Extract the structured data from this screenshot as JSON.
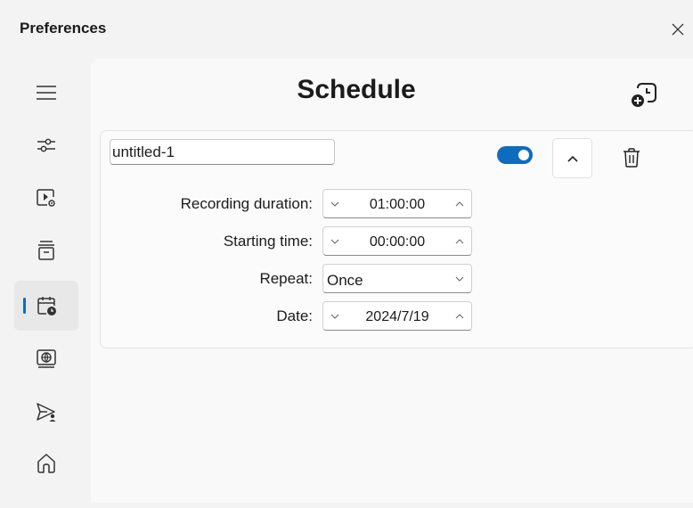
{
  "window": {
    "title": "Preferences"
  },
  "page": {
    "title": "Schedule"
  },
  "sidebar": {
    "items": [
      {
        "name": "menu-icon",
        "active": false
      },
      {
        "name": "sliders-icon",
        "active": false
      },
      {
        "name": "video-settings-icon",
        "active": false
      },
      {
        "name": "archive-icon",
        "active": false
      },
      {
        "name": "calendar-clock-icon",
        "active": true
      },
      {
        "name": "globe-screen-icon",
        "active": false
      },
      {
        "name": "send-person-icon",
        "active": false
      },
      {
        "name": "home-icon",
        "active": false
      }
    ]
  },
  "schedule": {
    "name": "untitled-1",
    "enabled": true,
    "fields": {
      "duration_label": "Recording duration:",
      "duration_value": "01:00:00",
      "start_label": "Starting time:",
      "start_value": "00:00:00",
      "repeat_label": "Repeat:",
      "repeat_value": "Once",
      "date_label": "Date:",
      "date_value": "2024/7/19"
    }
  },
  "colors": {
    "accent": "#0f6cbd",
    "background": "#f3f3f3",
    "panel": "#f9f9f9"
  }
}
